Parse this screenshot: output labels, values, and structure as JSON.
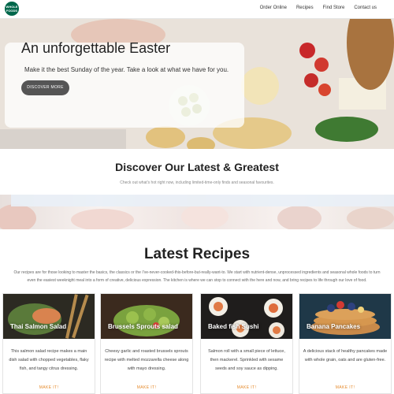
{
  "nav": {
    "logo": "WHOLE FOODS",
    "links": [
      "Order Online",
      "Recipes",
      "Find Store",
      "Contact us"
    ]
  },
  "hero": {
    "title": "An unforgettable Easter",
    "subtitle": "Make it the best Sunday of the year. Take a look at what we have for you.",
    "button": "DISCOVER MORE"
  },
  "discover": {
    "title": "Discover Our Latest & Greatest",
    "subtitle": "Check out what's hot right now, including limited-time-only finds and seasonal favourites."
  },
  "recipes": {
    "title": "Latest Recipes",
    "description_line1": "Our recipes are for those looking to master the basics, the classics or the I've-never-cooked-this-before-but-really-want-to. We start with nutrient-dense, unprocessed ingredients and seasonal whole foods to turn",
    "description_line2": "even the easiest weeknight meal into a form of creative, delicious expression. The kitchen is where we can stop to connect with the here and now, and bring recipes to life through our love of food.",
    "cards": [
      {
        "title": "Thai Salmon Salad",
        "desc": "This salmon salad recipe makes a main dish salad with chopped vegetables, flaky fish, and tangy citrus dressing.",
        "button": "MAKE IT!"
      },
      {
        "title": "Brussels Sprouts salad",
        "desc": "Cheesy garlic and roasted brussels sprouts recipe with melted mozzarella cheese along with mayo dressing.",
        "button": "MAKE IT!"
      },
      {
        "title": "Baked fish Sushi",
        "desc": "Salmon roll with a small piece of lettuce, then mackerel. Sprinkled with sesame seeds and soy sauce as dipping.",
        "button": "MAKE IT!"
      },
      {
        "title": "Banana Pancakes",
        "desc": "A delicious stack of healthy pancakes made with whole grain, oats and are gluten-free.",
        "button": "MAKE IT!"
      }
    ]
  },
  "colors": {
    "logo_green": "#00674b",
    "accent_orange": "#e58a2c",
    "hero_button": "#555555"
  }
}
